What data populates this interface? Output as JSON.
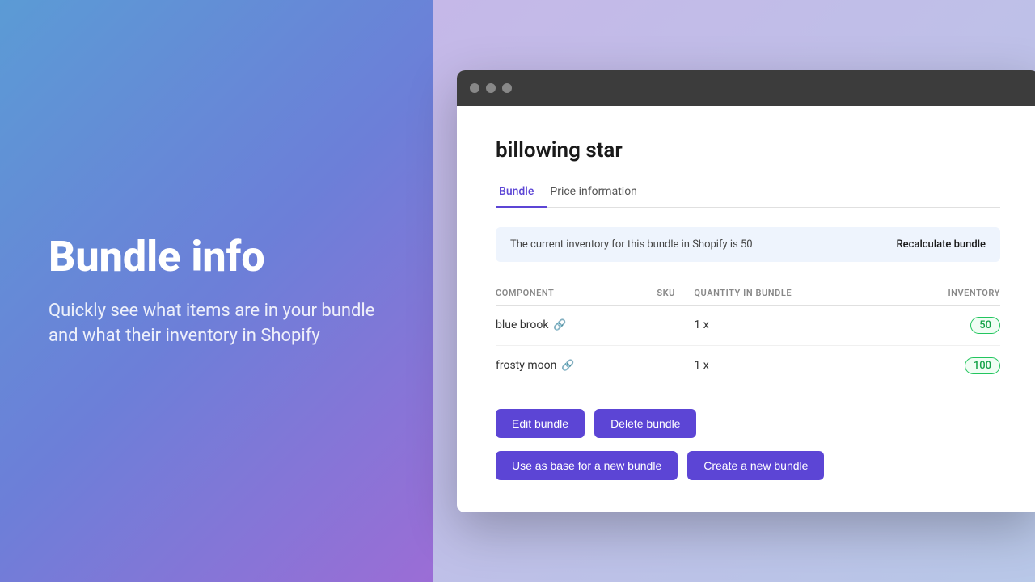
{
  "left": {
    "headline": "Bundle info",
    "subtext": "Quickly see what items are in your bundle and what their inventory in Shopify"
  },
  "browser": {
    "page_title": "billowing star",
    "tabs": [
      {
        "id": "bundle",
        "label": "Bundle",
        "active": true
      },
      {
        "id": "price",
        "label": "Price information",
        "active": false
      }
    ],
    "banner": {
      "text": "The current inventory for this bundle in Shopify is 50",
      "recalculate_label": "Recalculate bundle"
    },
    "table": {
      "headers": [
        "COMPONENT",
        "SKU",
        "QUANTITY IN BUNDLE",
        "INVENTORY"
      ],
      "rows": [
        {
          "component": "blue brook",
          "sku": "",
          "quantity": "1 x",
          "inventory": "50",
          "inventory_color": "green"
        },
        {
          "component": "frosty moon",
          "sku": "",
          "quantity": "1 x",
          "inventory": "100",
          "inventory_color": "green"
        }
      ]
    },
    "buttons": {
      "edit_label": "Edit bundle",
      "delete_label": "Delete bundle",
      "base_label": "Use as base for a new bundle",
      "create_label": "Create a new bundle"
    }
  },
  "colors": {
    "accent": "#5c45d5",
    "green_badge_text": "#16a34a",
    "green_badge_border": "#22c55e",
    "green_badge_bg": "#f0fdf4",
    "banner_bg": "#eef4fd"
  }
}
